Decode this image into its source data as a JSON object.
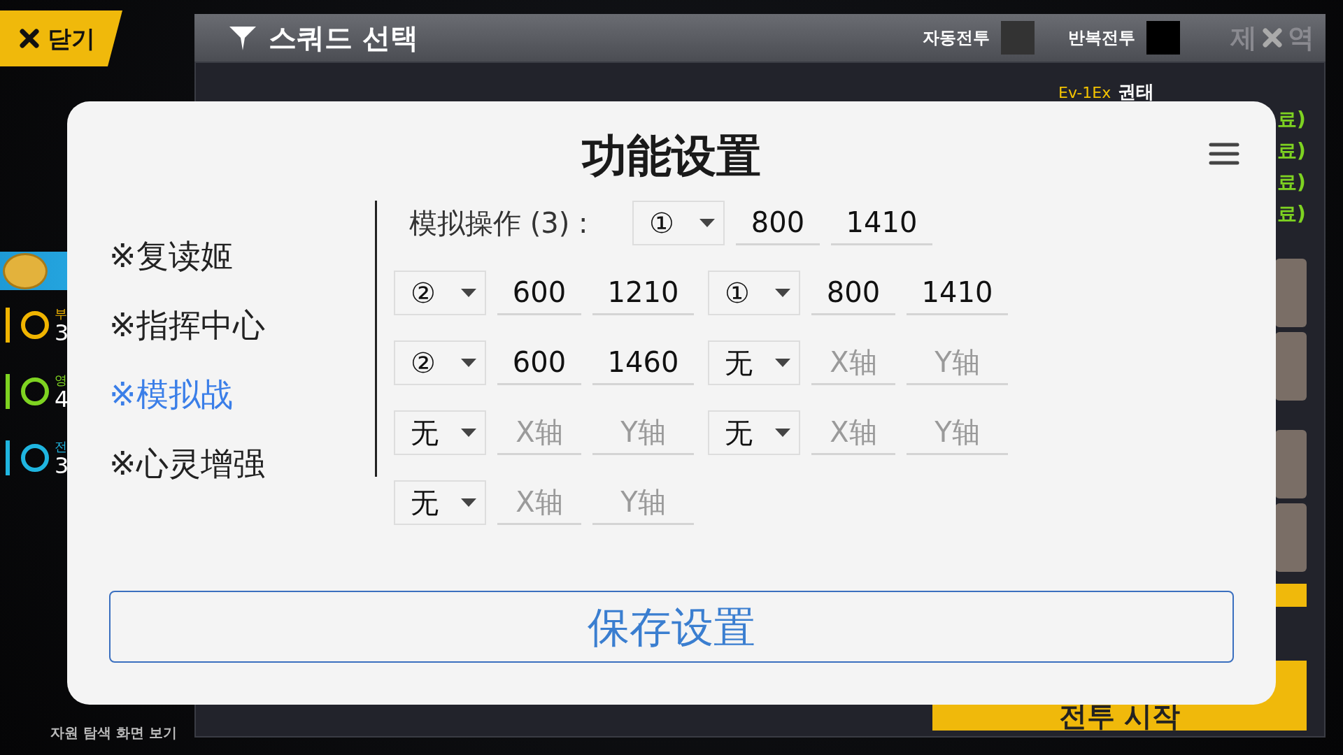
{
  "hud": {
    "close_button": "닫기",
    "title": "스쿼드 선택",
    "toggles": [
      {
        "label": "자동전투",
        "on": false
      },
      {
        "label": "반복전투",
        "on": true
      }
    ],
    "corner_texts": [
      "제",
      "역"
    ],
    "stage": {
      "code": "Ev-1Ex",
      "name": "권태"
    },
    "mission_status": [
      "료)",
      "료)",
      "료)",
      "료)"
    ],
    "resources": [
      {
        "label": "부",
        "value": "3",
        "color": "#f0b400"
      },
      {
        "label": "영",
        "value": "4",
        "color": "#7ed321"
      },
      {
        "label": "전",
        "value": "3",
        "color": "#1fb5e0"
      }
    ],
    "footer_link": "자원 탐색 화면 보기",
    "start_button": "전투 시작"
  },
  "dialog": {
    "title": "功能设置",
    "menu": [
      {
        "label": "※复读姬",
        "selected": false
      },
      {
        "label": "※指挥中心",
        "selected": false
      },
      {
        "label": "※模拟战",
        "selected": true
      },
      {
        "label": "※心灵增强",
        "selected": false
      }
    ],
    "rows": [
      {
        "label": "模拟操作 (3) :",
        "slots": [
          {
            "select": "①",
            "x": {
              "value": "800"
            },
            "y": {
              "value": "1410"
            }
          }
        ]
      },
      {
        "slots": [
          {
            "select": "②",
            "x": {
              "value": "600"
            },
            "y": {
              "value": "1210"
            }
          },
          {
            "select": "①",
            "x": {
              "value": "800"
            },
            "y": {
              "value": "1410"
            }
          }
        ]
      },
      {
        "slots": [
          {
            "select": "②",
            "x": {
              "value": "600"
            },
            "y": {
              "value": "1460"
            }
          },
          {
            "select": "无",
            "x": {
              "placeholder": "X轴"
            },
            "y": {
              "placeholder": "Y轴"
            }
          }
        ]
      },
      {
        "slots": [
          {
            "select": "无",
            "x": {
              "placeholder": "X轴"
            },
            "y": {
              "placeholder": "Y轴"
            }
          },
          {
            "select": "无",
            "x": {
              "placeholder": "X轴"
            },
            "y": {
              "placeholder": "Y轴"
            }
          }
        ]
      },
      {
        "slots": [
          {
            "select": "无",
            "x": {
              "placeholder": "X轴"
            },
            "y": {
              "placeholder": "Y轴"
            }
          }
        ]
      }
    ],
    "save_button": "保存设置"
  }
}
